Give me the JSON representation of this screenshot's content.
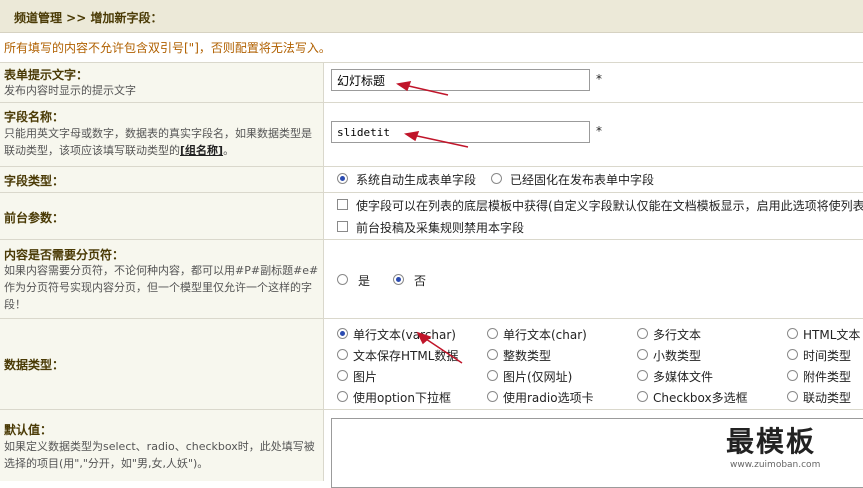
{
  "header": {
    "breadcrumb": "频道管理 >> 增加新字段："
  },
  "warning": "所有填写的内容不允许包含双引号[\"]，否则配置将无法写入。",
  "form": {
    "title_field": {
      "label": "表单提示文字：",
      "desc": "发布内容时显示的提示文字",
      "value": "幻灯标题",
      "required": "*"
    },
    "name_field": {
      "label": "字段名称：",
      "desc": "只能用英文字母或数字，数据表的真实字段名，如果数据类型是联动类型，该项应该填写联动类型的",
      "desc_link": "[组名称]",
      "desc_end": "。",
      "value": "slidetit",
      "required": "*"
    },
    "field_type": {
      "label": "字段类型：",
      "options": [
        "系统自动生成表单字段",
        "已经固化在发布表单中字段"
      ]
    },
    "frontend": {
      "label": "前台参数：",
      "options": [
        "使字段可以在列表的底层模板中获得(自定义字段默认仅能在文档模板显示，启用此选项将使列表",
        "前台投稿及采集规则禁用本字段"
      ]
    },
    "paging": {
      "label": "内容是否需要分页符：",
      "desc": "如果内容需要分页符，不论何种内容，都可以用#P#副标题#e#作为分页符号实现内容分页，但一个模型里仅允许一个这样的字段！",
      "options": [
        "是",
        "否"
      ]
    },
    "data_type": {
      "label": "数据类型：",
      "options": [
        [
          "单行文本(varchar)",
          "单行文本(char)",
          "多行文本",
          "HTML文本"
        ],
        [
          "文本保存HTML数据",
          "整数类型",
          "小数类型",
          "时间类型"
        ],
        [
          "图片",
          "图片(仅网址)",
          "多媒体文件",
          "附件类型"
        ],
        [
          "使用option下拉框",
          "使用radio选项卡",
          "Checkbox多选框",
          "联动类型"
        ]
      ]
    },
    "default_val": {
      "label": "默认值：",
      "desc": "如果定义数据类型为select、radio、checkbox时，此处填写被选择的项目(用\",\"分开，如\"男,女,人妖\")。"
    }
  },
  "watermark": {
    "text": "最模板",
    "url": "www.zuimoban.com"
  },
  "colors": {
    "label_text": "#4a3a05",
    "warning": "#b06000",
    "arrow": "#c0152a"
  }
}
